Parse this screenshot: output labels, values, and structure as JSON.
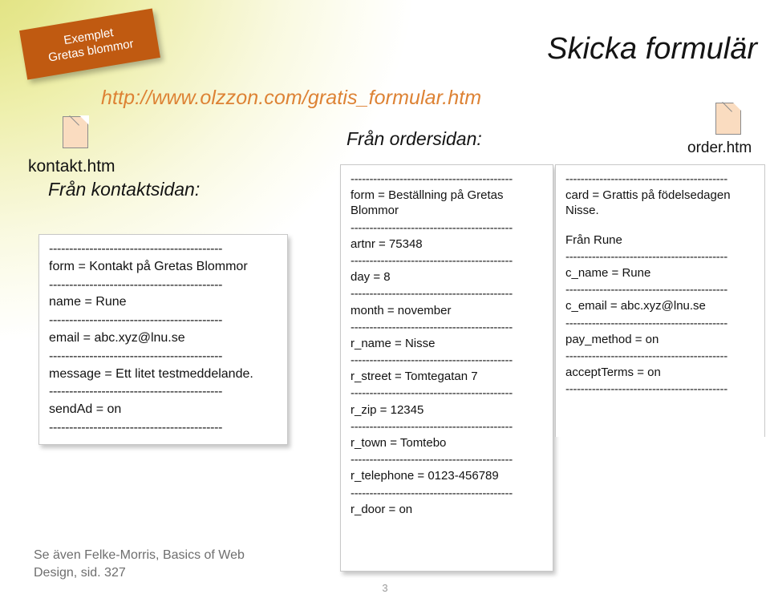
{
  "slide": {
    "title": "Skicka formulär",
    "url": "http://www.olzzon.com/gratis_formular.htm",
    "page_number": "3",
    "footnote": "Se även Felke-Morris, Basics of Web Design, sid. 327",
    "ribbon": {
      "line1": "Exemplet",
      "line2": "Gretas blommor",
      "color": "#c05a11"
    },
    "background": {
      "accent": "#dfe07a",
      "base": "#ffffff"
    }
  },
  "files": {
    "kontakt": {
      "icon": "file-icon",
      "label": "kontakt.htm"
    },
    "order": {
      "icon": "file-icon",
      "label": "order.htm"
    }
  },
  "headings": {
    "kontakt": "Från kontaktsidan:",
    "order": "Från ordersidan:"
  },
  "separator": "-------------------------------------------",
  "panels": {
    "kontakt": {
      "rows": [
        "form = Kontakt på Gretas Blommor",
        "name = Rune",
        "email = abc.xyz@lnu.se",
        "message = Ett litet testmeddelande.",
        "sendAd = on"
      ]
    },
    "order": {
      "rows": [
        "form = Beställning på Gretas Blommor",
        "artnr = 75348",
        "day = 8",
        "month = november",
        "r_name = Nisse",
        "r_street = Tomtegatan 7",
        "r_zip = 12345",
        "r_town = Tomtebo",
        "r_telephone = 0123-456789",
        "r_door = on"
      ]
    },
    "card": {
      "rows": [
        "card = Grattis på födelsedagen Nisse.",
        "Från Rune",
        "c_name = Rune",
        "c_email = abc.xyz@lnu.se",
        "pay_method = on",
        "acceptTerms = on"
      ]
    }
  }
}
